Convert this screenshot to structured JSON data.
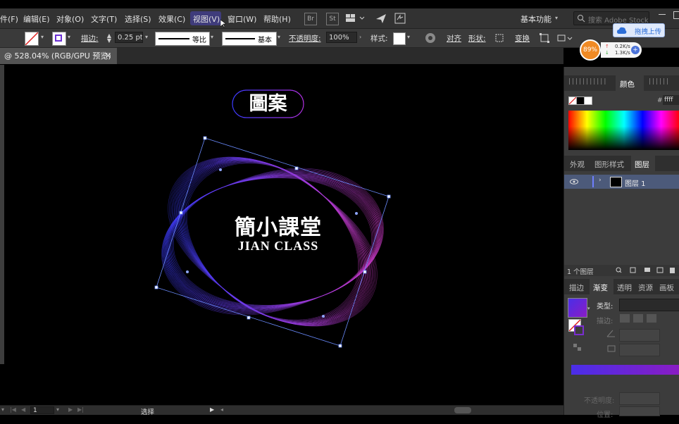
{
  "menu": {
    "items": [
      "件(F)",
      "编辑(E)",
      "对象(O)",
      "文字(T)",
      "选择(S)",
      "效果(C)",
      "视图(V)",
      "窗口(W)",
      "帮助(H)"
    ],
    "bridge_label": "Br",
    "stock_label": "St",
    "workspace_label": "基本功能",
    "search_placeholder": "搜索 Adobe Stock"
  },
  "cloud_button": {
    "label": "拖拽上传"
  },
  "net_widget": {
    "percent": "89%",
    "up": "0.2K/s",
    "down": "1.3K/s"
  },
  "control": {
    "stroke_label": "描边:",
    "stroke_value": "0.25 pt",
    "profile_label": "等比",
    "brush_label": "基本",
    "opacity_label": "不透明度:",
    "opacity_value": "100%",
    "style_label": "样式:",
    "align_label": "对齐",
    "shape_label": "形状:",
    "transform_label": "变换"
  },
  "document": {
    "tab_title": "@ 528.04% (RGB/GPU 预览)",
    "close": "×"
  },
  "artwork": {
    "badge_text": "圖案",
    "title": "簡小課堂",
    "subtitle": "JIAN CLASS",
    "colors": {
      "blue": "#3b3bff",
      "purple": "#b030e0",
      "pink": "#d13acb"
    }
  },
  "status": {
    "page_value": "1",
    "tool_label": "选择"
  },
  "panels": {
    "color_tab": "颜色",
    "hex_value": "ffff",
    "tabs_mid": [
      "外观",
      "图形样式",
      "图层"
    ],
    "layer_name": "图层 1",
    "layer_count": "1 个图层",
    "tabs_bottom": [
      "描边",
      "渐变",
      "透明",
      "资源",
      "画板"
    ],
    "gradient_type_label": "类型:",
    "gradient_stroke_label": "描边:",
    "opacity_label": "不透明度:",
    "position_label": "位置:",
    "gradient_colors": {
      "start": "#4a2ee8",
      "end": "#8a1cc4"
    }
  }
}
